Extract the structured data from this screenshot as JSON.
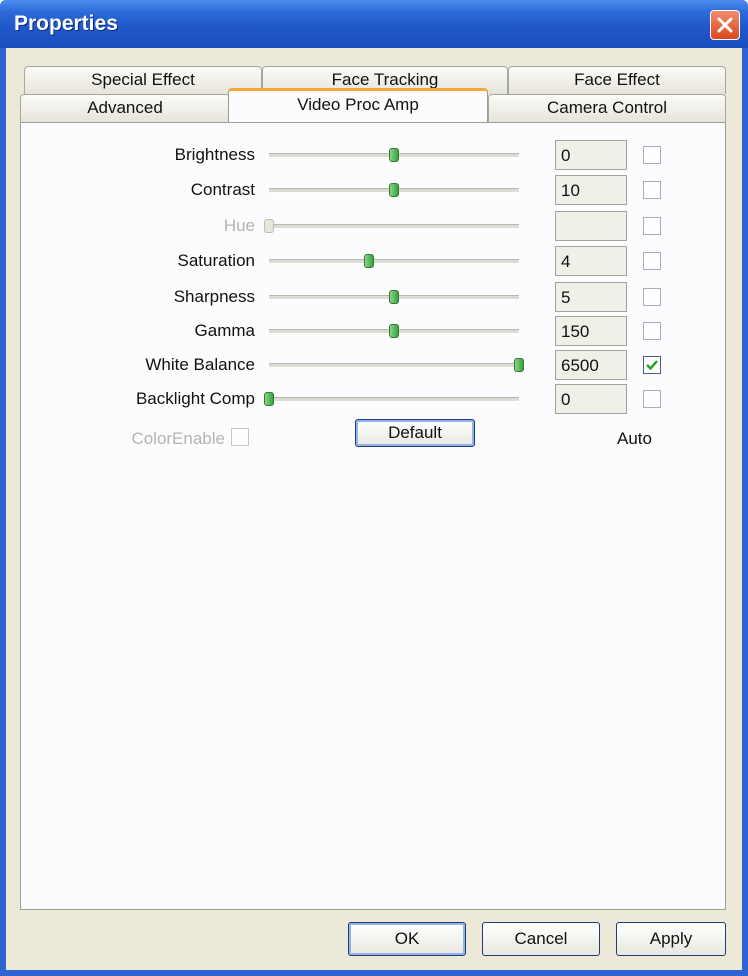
{
  "window": {
    "title": "Properties"
  },
  "tabs": {
    "row1": [
      "Special Effect",
      "Face Tracking",
      "Face Effect"
    ],
    "row2": [
      "Advanced",
      "Video Proc Amp",
      "Camera Control"
    ],
    "active": "Video Proc Amp"
  },
  "controls": [
    {
      "label": "Brightness",
      "value": "0",
      "level": 0.5,
      "auto": false,
      "disabled": false
    },
    {
      "label": "Contrast",
      "value": "10",
      "level": 0.5,
      "auto": false,
      "disabled": false
    },
    {
      "label": "Hue",
      "value": "",
      "level": 0.0,
      "auto": false,
      "disabled": true
    },
    {
      "label": "Saturation",
      "value": "4",
      "level": 0.4,
      "auto": false,
      "disabled": false
    },
    {
      "label": "Sharpness",
      "value": "5",
      "level": 0.5,
      "auto": false,
      "disabled": false
    },
    {
      "label": "Gamma",
      "value": "150",
      "level": 0.5,
      "auto": false,
      "disabled": false
    },
    {
      "label": "White Balance",
      "value": "6500",
      "level": 1.0,
      "auto": true,
      "disabled": false
    },
    {
      "label": "Backlight Comp",
      "value": "0",
      "level": 0.0,
      "auto": false,
      "disabled": false
    }
  ],
  "color_enable": {
    "label": "ColorEnable",
    "checked": false
  },
  "default_button": "Default",
  "auto_label": "Auto",
  "buttons": {
    "ok": "OK",
    "cancel": "Cancel",
    "apply": "Apply"
  },
  "colors": {
    "title_bar": "#2455c8",
    "accent_tab": "#f3a83a",
    "slider_thumb": "#3aa544",
    "close_button": "#d9481f"
  },
  "icons": {
    "close": "close-icon",
    "check": "check-icon"
  }
}
